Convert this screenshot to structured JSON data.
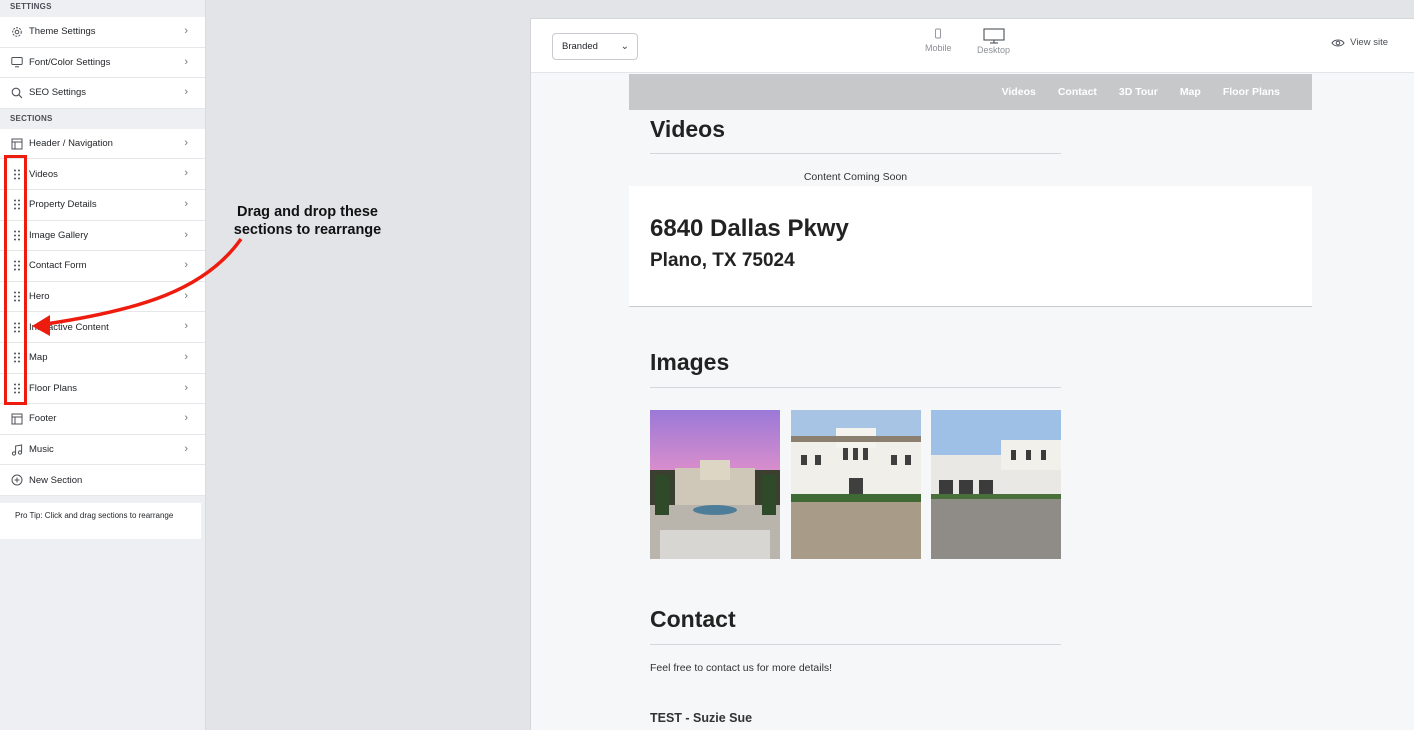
{
  "sidebar": {
    "settings_heading": "SETTINGS",
    "settings": [
      {
        "label": "Theme Settings",
        "icon": "gear-icon"
      },
      {
        "label": "Font/Color Settings",
        "icon": "monitor-icon"
      },
      {
        "label": "SEO Settings",
        "icon": "search-icon"
      }
    ],
    "sections_heading": "SECTIONS",
    "header_item": {
      "label": "Header / Navigation",
      "icon": "layout-icon"
    },
    "draggable": [
      "Videos",
      "Property Details",
      "Image Gallery",
      "Contact Form",
      "Hero",
      "Interactive Content",
      "Map",
      "Floor Plans"
    ],
    "footer_item": {
      "label": "Footer",
      "icon": "layout-icon"
    },
    "music_item": {
      "label": "Music",
      "icon": "music-note-icon"
    },
    "new_section": {
      "label": "New Section",
      "icon": "plus-circle-icon"
    },
    "pro_tip": "Pro Tip: Click and drag sections to rearrange"
  },
  "annotation": {
    "text": "Drag and drop these sections to rearrange",
    "color": "#ee1c0e"
  },
  "toolbar": {
    "theme_select": "Branded",
    "mobile_label": "Mobile",
    "desktop_label": "Desktop",
    "view_site": "View site"
  },
  "site": {
    "nav": [
      "Videos",
      "Contact",
      "3D Tour",
      "Map",
      "Floor Plans"
    ],
    "videos_title": "Videos",
    "videos_placeholder": "Content Coming Soon",
    "address_line1": "6840 Dallas Pkwy",
    "address_line2": "Plano, TX 75024",
    "images_title": "Images",
    "contact_title": "Contact",
    "contact_text": "Feel free to contact us for more details!",
    "agent_name": "TEST - Suzie Sue"
  }
}
